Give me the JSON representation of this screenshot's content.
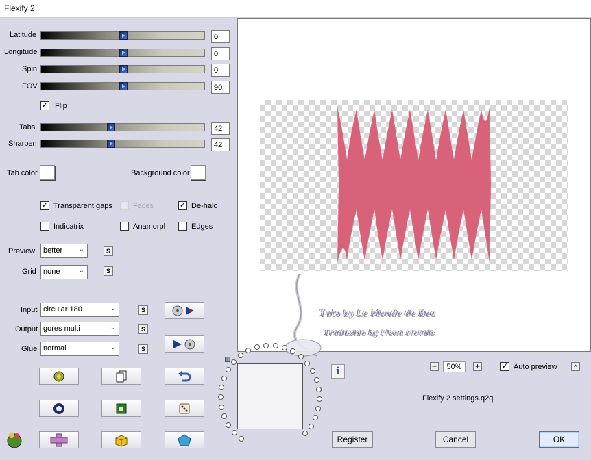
{
  "window": {
    "title": "Flexify 2"
  },
  "sliders": [
    {
      "label": "Latitude",
      "value": "0",
      "level": 0.5
    },
    {
      "label": "Longitude",
      "value": "0",
      "level": 0.5
    },
    {
      "label": "Spin",
      "value": "0",
      "level": 0.5
    },
    {
      "label": "FOV",
      "value": "90",
      "level": 0.5
    },
    {
      "label": "Tabs",
      "value": "42",
      "level": 0.42
    },
    {
      "label": "Sharpen",
      "value": "42",
      "level": 0.42
    }
  ],
  "flip": {
    "label": "Flip",
    "checked": true
  },
  "colors": {
    "tab_color_label": "Tab color",
    "background_color_label": "Background color"
  },
  "options": {
    "transparent_gaps": {
      "label": "Transparent gaps",
      "checked": true
    },
    "faces": {
      "label": "Faces",
      "checked": false,
      "disabled": true
    },
    "de_halo": {
      "label": "De-halo",
      "checked": true
    },
    "indicatrix": {
      "label": "Indicatrix",
      "checked": false
    },
    "anamorph": {
      "label": "Anamorph",
      "checked": false
    },
    "edges": {
      "label": "Edges",
      "checked": false
    }
  },
  "preview_quality": {
    "label": "Preview",
    "value": "better"
  },
  "grid": {
    "label": "Grid",
    "value": "none"
  },
  "input": {
    "label": "Input",
    "value": "circular 180"
  },
  "output": {
    "label": "Output",
    "value": "gores multi"
  },
  "glue": {
    "label": "Glue",
    "value": "normal"
  },
  "s_label": "S",
  "zoom": {
    "value": "50%",
    "minus": "−",
    "plus": "+"
  },
  "auto_preview": {
    "label": "Auto preview",
    "checked": true
  },
  "settings_file": "Flexify 2 settings.q2q",
  "watermark": {
    "line1": "Tuto by Le Monde de Bea",
    "line2": "Traduzido by Nena Novais"
  },
  "buttons": {
    "register": "Register",
    "cancel": "Cancel",
    "ok": "OK"
  },
  "info_icon": "i",
  "colors_hex": {
    "shape": "#d8627a",
    "accent": "#3478d0"
  }
}
